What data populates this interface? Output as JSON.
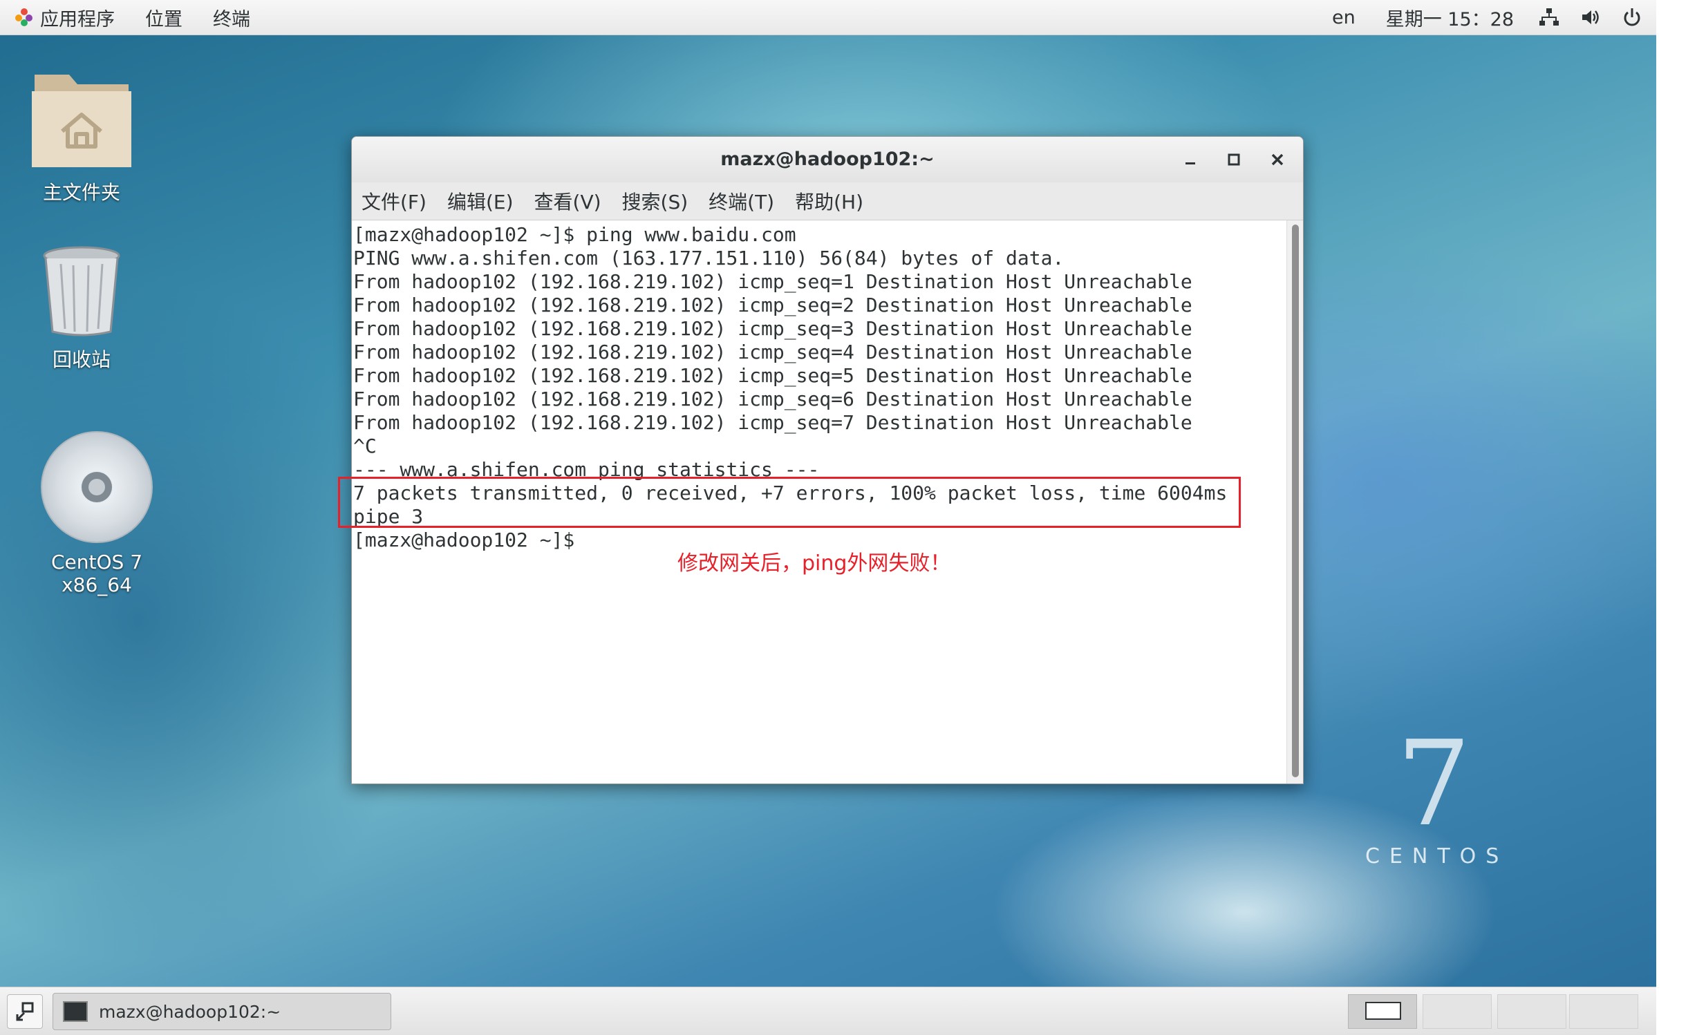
{
  "top_panel": {
    "applications": "应用程序",
    "places": "位置",
    "terminal": "终端",
    "language": "en",
    "datetime": "星期一 15：28"
  },
  "desktop_icons": {
    "home_folder": "主文件夹",
    "trash": "回收站",
    "cdrom": "CentOS 7 x86_64"
  },
  "window": {
    "title": "mazx@hadoop102:~",
    "menu": [
      "文件(F)",
      "编辑(E)",
      "查看(V)",
      "搜索(S)",
      "终端(T)",
      "帮助(H)"
    ]
  },
  "terminal_lines": [
    "[mazx@hadoop102 ~]$ ping www.baidu.com",
    "PING www.a.shifen.com (163.177.151.110) 56(84) bytes of data.",
    "From hadoop102 (192.168.219.102) icmp_seq=1 Destination Host Unreachable",
    "From hadoop102 (192.168.219.102) icmp_seq=2 Destination Host Unreachable",
    "From hadoop102 (192.168.219.102) icmp_seq=3 Destination Host Unreachable",
    "From hadoop102 (192.168.219.102) icmp_seq=4 Destination Host Unreachable",
    "From hadoop102 (192.168.219.102) icmp_seq=5 Destination Host Unreachable",
    "From hadoop102 (192.168.219.102) icmp_seq=6 Destination Host Unreachable",
    "From hadoop102 (192.168.219.102) icmp_seq=7 Destination Host Unreachable",
    "^C",
    "--- www.a.shifen.com ping statistics ---",
    "7 packets transmitted, 0 received, +7 errors, 100% packet loss, time 6004ms",
    "pipe 3",
    "[mazx@hadoop102 ~]$"
  ],
  "annotation": "修改网关后，ping外网失败！",
  "branding": {
    "seven": "7",
    "centos": "CENTOS"
  },
  "taskbar": {
    "task_label": "mazx@hadoop102:~"
  },
  "colors": {
    "annotation_red": "#e8202a",
    "terminal_text": "#2e3436"
  }
}
